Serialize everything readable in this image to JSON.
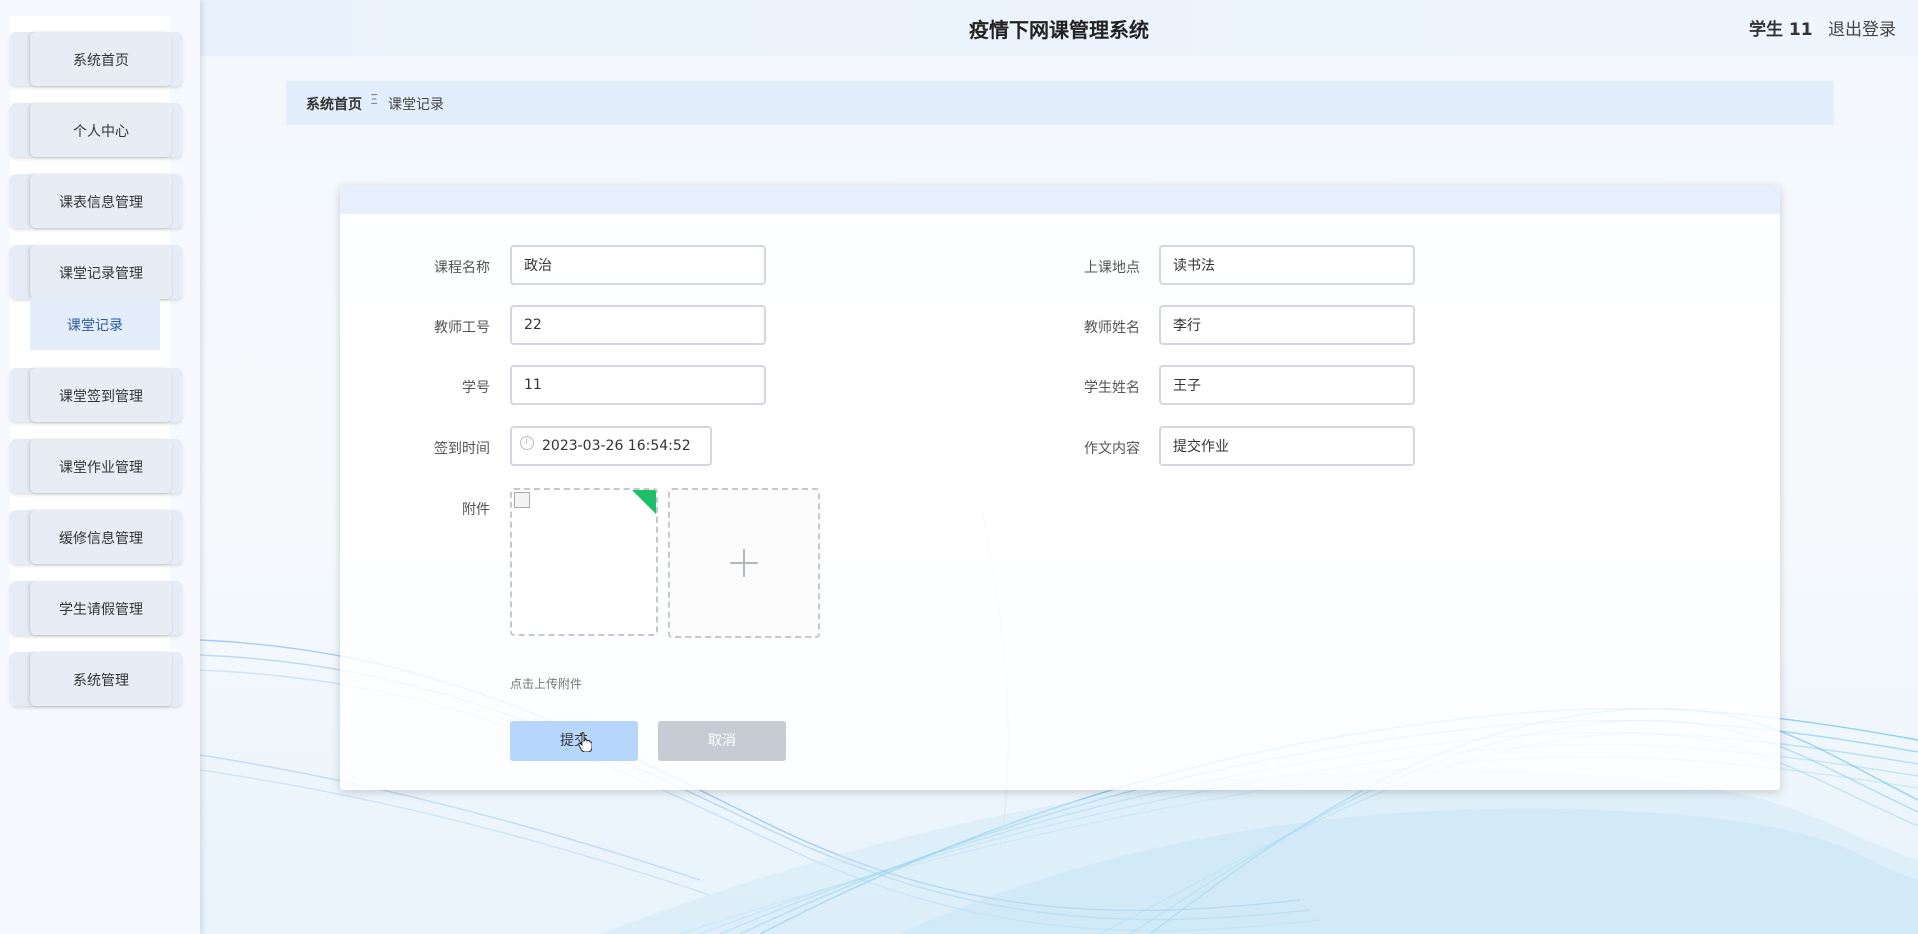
{
  "header": {
    "title": "疫情下网课管理系统",
    "user": "学生 11",
    "logout": "退出登录"
  },
  "sidebar": {
    "items": [
      {
        "label": "系统首页"
      },
      {
        "label": "个人中心"
      },
      {
        "label": "课表信息管理"
      },
      {
        "label": "课堂记录管理"
      },
      {
        "label": "课堂签到管理"
      },
      {
        "label": "课堂作业管理"
      },
      {
        "label": "缓修信息管理"
      },
      {
        "label": "学生请假管理"
      },
      {
        "label": "系统管理"
      }
    ],
    "subitem": {
      "label": "课堂记录"
    }
  },
  "breadcrumb": {
    "home": "系统首页",
    "separator": "Ξ",
    "current": "课堂记录"
  },
  "form": {
    "course_name": {
      "label": "课程名称",
      "value": "政治"
    },
    "location": {
      "label": "上课地点",
      "value": "读书法"
    },
    "teacher_id": {
      "label": "教师工号",
      "value": "22"
    },
    "teacher_name": {
      "label": "教师姓名",
      "value": "李行"
    },
    "student_id": {
      "label": "学号",
      "value": "11"
    },
    "student_name": {
      "label": "学生姓名",
      "value": "王子"
    },
    "signin_time": {
      "label": "签到时间",
      "value": "2023-03-26 16:54:52"
    },
    "content": {
      "label": "作文内容",
      "value": "提交作业"
    },
    "attachment": {
      "label": "附件",
      "hint": "点击上传附件"
    },
    "submit": "提交",
    "cancel": "取消"
  },
  "colors": {
    "accent": "#b7d6fb",
    "cancel": "#c7ccd4",
    "upload_corner": "#1fbf6a"
  },
  "icons": {
    "time": "clock-icon",
    "upload_add": "plus-icon"
  }
}
